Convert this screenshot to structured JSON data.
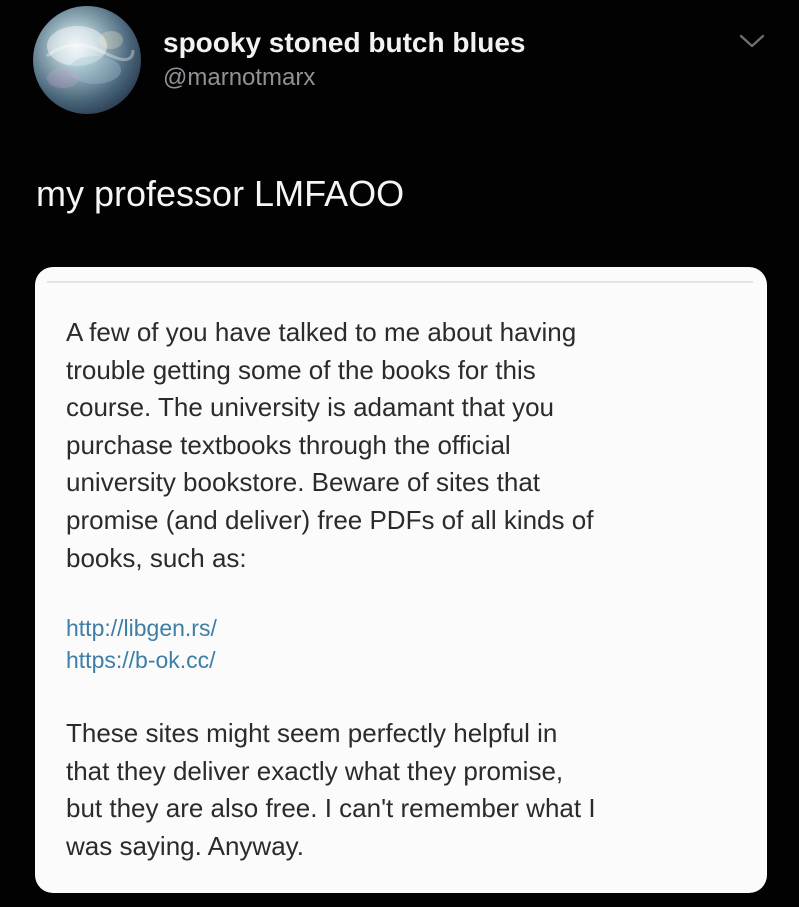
{
  "author": {
    "display_name": "spooky stoned butch blues",
    "handle": "@marnotmarx",
    "avatar_icon": "profile-avatar"
  },
  "menu": {
    "icon": "chevron-down-icon"
  },
  "tweet": {
    "text": "my professor LMFAOO"
  },
  "card": {
    "paragraph1": "A few of you have talked to me about having\ntrouble getting some of the books for this\ncourse. The university is adamant that you\npurchase textbooks through the official\nuniversity bookstore. Beware of sites that\npromise (and deliver) free PDFs of all kinds of\nbooks, such as:",
    "links": [
      "http://libgen.rs/",
      "https://b-ok.cc/"
    ],
    "paragraph2": "These sites might seem perfectly helpful in\nthat they deliver exactly what they promise,\nbut they are also free. I can't remember what I\nwas saying. Anyway."
  },
  "colors": {
    "background": "#020202",
    "card_background": "#fbfbfb",
    "name_text": "#f2f2f2",
    "handle_text": "#8f9296",
    "link": "#3d7ea6",
    "body_text": "#2b2b2b"
  }
}
